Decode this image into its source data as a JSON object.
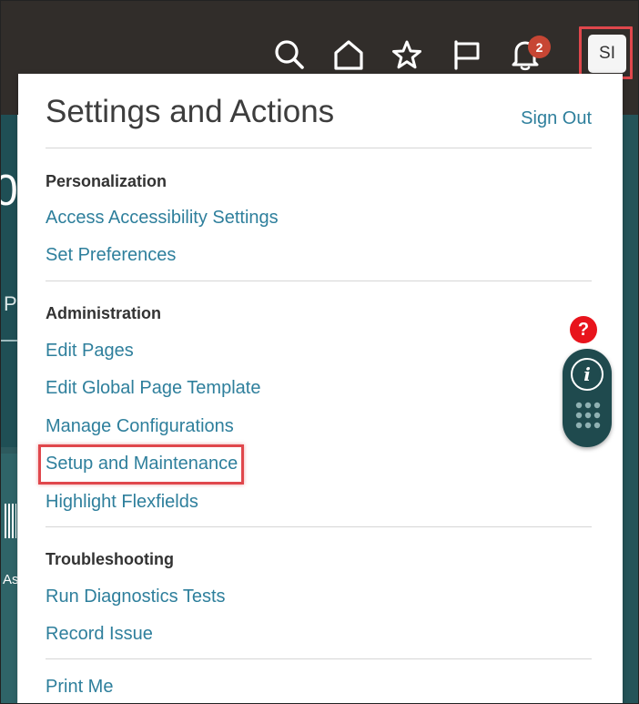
{
  "header": {
    "notification_count": "2",
    "user_initials": "SI"
  },
  "icons": {
    "search": "search-icon",
    "home": "home-icon",
    "favorites": "star-icon",
    "watchlist": "flag-icon",
    "notifications": "bell-icon",
    "help": "question-icon",
    "info": "info-icon",
    "apps": "grid-icon"
  },
  "left_fragments": {
    "top": "0",
    "middle": "P",
    "bottom": "As"
  },
  "panel": {
    "title": "Settings and Actions",
    "sign_out": "Sign Out",
    "sections": [
      {
        "heading": "Personalization",
        "items": [
          "Access Accessibility Settings",
          "Set Preferences"
        ]
      },
      {
        "heading": "Administration",
        "items": [
          "Edit Pages",
          "Edit Global Page Template",
          "Manage Configurations",
          "Setup and Maintenance",
          "Highlight Flexfields"
        ]
      },
      {
        "heading": "Troubleshooting",
        "items": [
          "Run Diagnostics Tests",
          "Record Issue"
        ]
      }
    ],
    "footer_item": "Print Me"
  },
  "help_badge": "?",
  "info_letter": "i",
  "colors": {
    "header_bg": "#312d2a",
    "link": "#2e7f9c",
    "highlight": "#e0474c",
    "badge": "#c74634",
    "widget": "#1f4a4e"
  }
}
